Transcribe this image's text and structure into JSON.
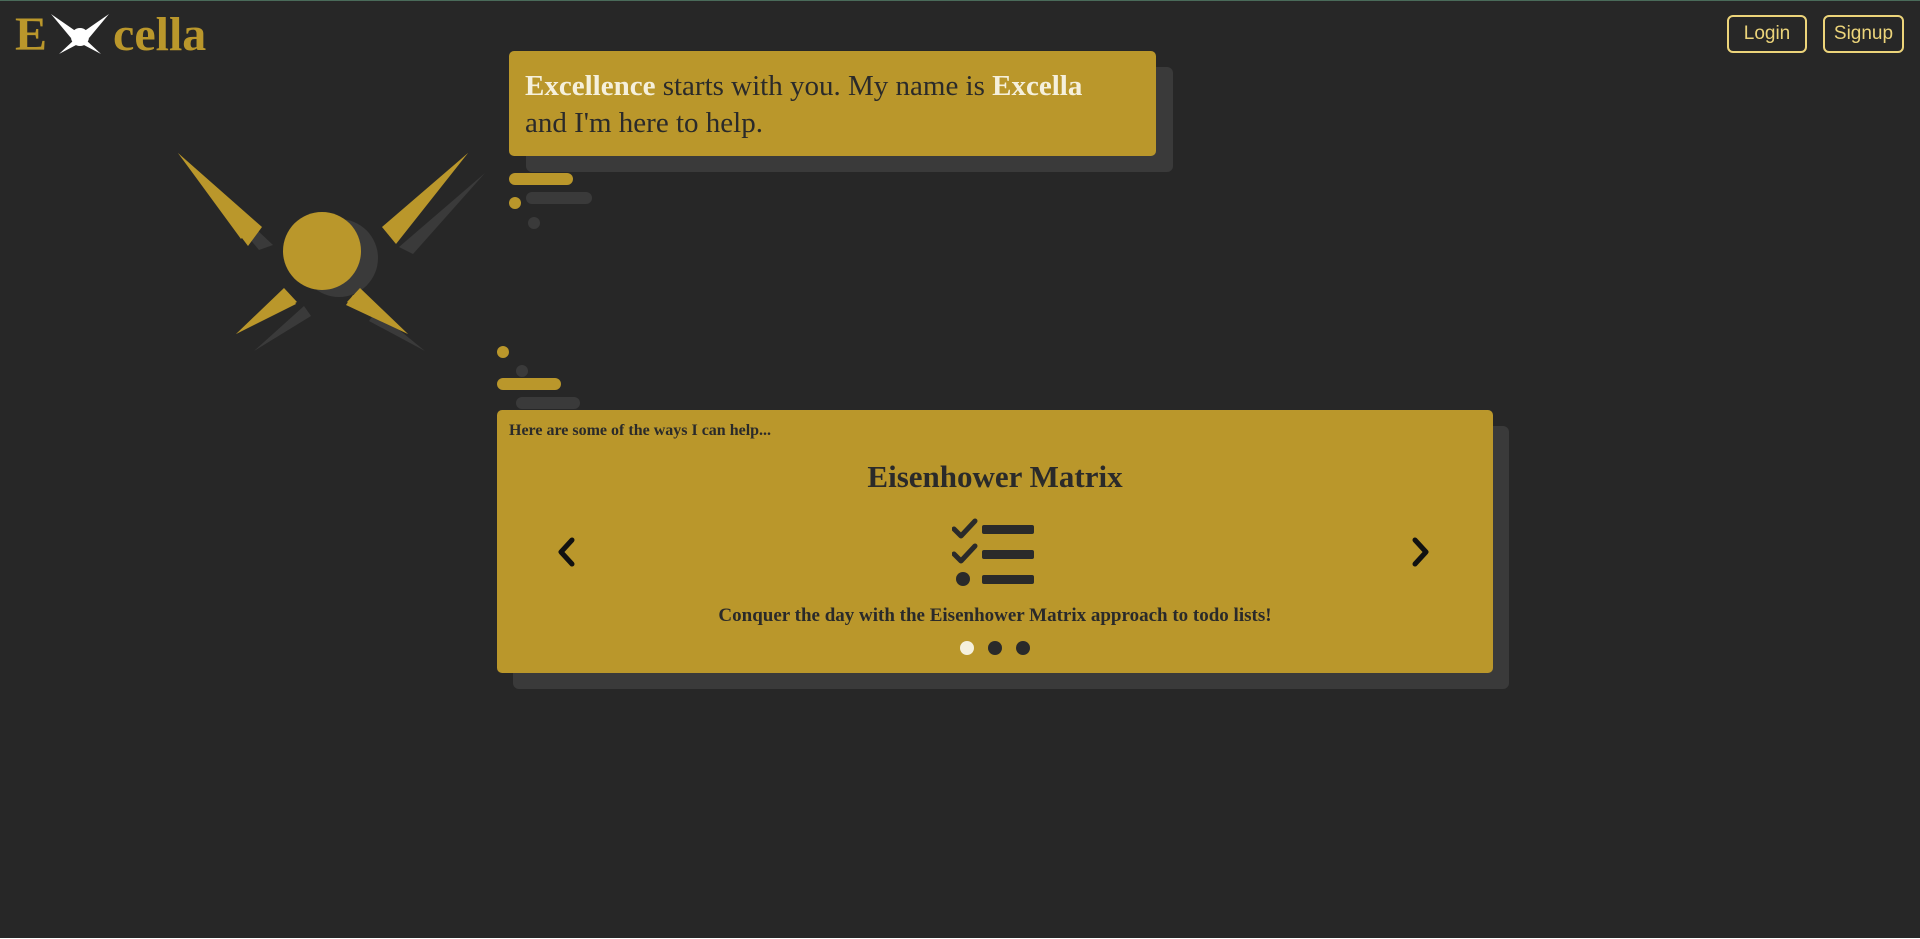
{
  "header": {
    "logo_prefix": "E",
    "logo_suffix": "cella",
    "login_label": "Login",
    "signup_label": "Signup"
  },
  "bubble": {
    "bold_1": "Excellence",
    "text_1": " starts with you. My name is ",
    "bold_2": "Excella",
    "text_2": "and I'm here to help."
  },
  "carousel": {
    "intro": "Here are some of the ways I can help...",
    "title": "Eisenhower Matrix",
    "description": "Conquer the day with the Eisenhower Matrix approach to todo lists!",
    "icon": "tasks-list-icon",
    "slide_count": 3,
    "active_slide": 1
  },
  "colors": {
    "background": "#272727",
    "accent": "#ba972b",
    "accent_light": "#ecd47a",
    "text_dark": "#2a2a2a",
    "text_light": "#f5f0dc",
    "shadow": "#3a3a3a"
  }
}
